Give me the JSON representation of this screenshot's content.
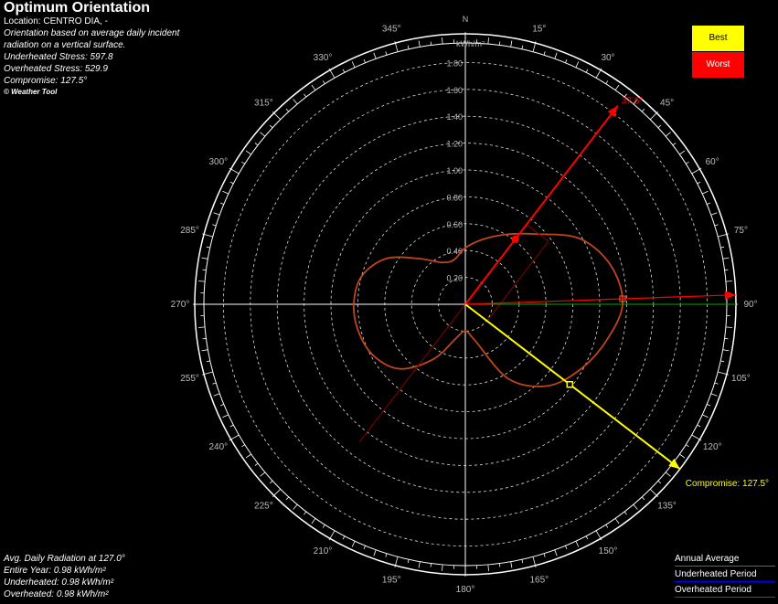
{
  "header": {
    "title": "Optimum Orientation",
    "location": "Location: CENTRO DIA, -",
    "desc1": "Orientation based on average daily incident",
    "desc2": "radiation on a vertical surface.",
    "underheated_stress": "Underheated Stress: 597.8",
    "overheated_stress": "Overheated Stress: 529.9",
    "compromise": "Compromise: 127.5°",
    "copyright": "© Weather Tool"
  },
  "bottom_info": {
    "heading": "Avg. Daily Radiation at 127.0°",
    "entire_year": "Entire Year: 0.98 kWh/m²",
    "underheated": "Underheated: 0.98 kWh/m²",
    "overheated": "Overheated: 0.98 kWh/m²"
  },
  "legend_buttons": {
    "best": "Best",
    "worst": "Worst"
  },
  "colors": {
    "best": "#ffff00",
    "worst": "#ff0000",
    "annual": "#00aa00",
    "underheated": "#0000ff",
    "overheated": "#ff0000",
    "curve": "#c0441c",
    "compromise": "#ffff00"
  },
  "chart_data": {
    "type": "polar",
    "radial_unit": "kWh/m²",
    "radial_range": [
      0,
      2.0
    ],
    "radial_ticks": [
      "0.20",
      "0.40",
      "0.60",
      "0.80",
      "1.00",
      "1.20",
      "1.40",
      "1.60",
      "1.80"
    ],
    "radial_tick_values": [
      0.2,
      0.4,
      0.6,
      0.8,
      1.0,
      1.2,
      1.4,
      1.6,
      1.8
    ],
    "north_label": "N",
    "angle_labels": [
      "345°",
      "15°",
      "330°",
      "30°",
      "45°",
      "315°",
      "300°",
      "60°",
      "285°",
      "75°",
      "270°",
      "90°",
      "255°",
      "105°",
      "240°",
      "120°",
      "225°",
      "135°",
      "210°",
      "150°",
      "195°",
      "165°",
      "180°"
    ],
    "angle_values": [
      345,
      15,
      330,
      30,
      45,
      315,
      300,
      60,
      285,
      75,
      270,
      90,
      255,
      105,
      240,
      120,
      225,
      135,
      210,
      150,
      195,
      165,
      180
    ],
    "series": [
      {
        "name": "Annual Average",
        "angles": [
          0,
          15,
          30,
          45,
          60,
          75,
          90,
          105,
          120,
          135,
          150,
          165,
          180,
          195,
          210,
          225,
          240,
          255,
          270,
          285,
          300,
          315,
          330,
          345
        ],
        "values": [
          0.42,
          0.5,
          0.6,
          0.74,
          0.98,
          1.12,
          1.17,
          1.08,
          0.98,
          0.86,
          0.64,
          0.28,
          0.2,
          0.26,
          0.47,
          0.68,
          0.78,
          0.82,
          0.83,
          0.8,
          0.68,
          0.48,
          0.36,
          0.34
        ]
      }
    ],
    "best_orientation": {
      "angle": 37.5,
      "label": "37.5°"
    },
    "compromise_orientation": {
      "angle": 127.5,
      "label": "Compromise: 127.5°"
    }
  },
  "series_legend": {
    "annual": "Annual Average",
    "underheated": "Underheated Period",
    "overheated": "Overheated Period"
  }
}
